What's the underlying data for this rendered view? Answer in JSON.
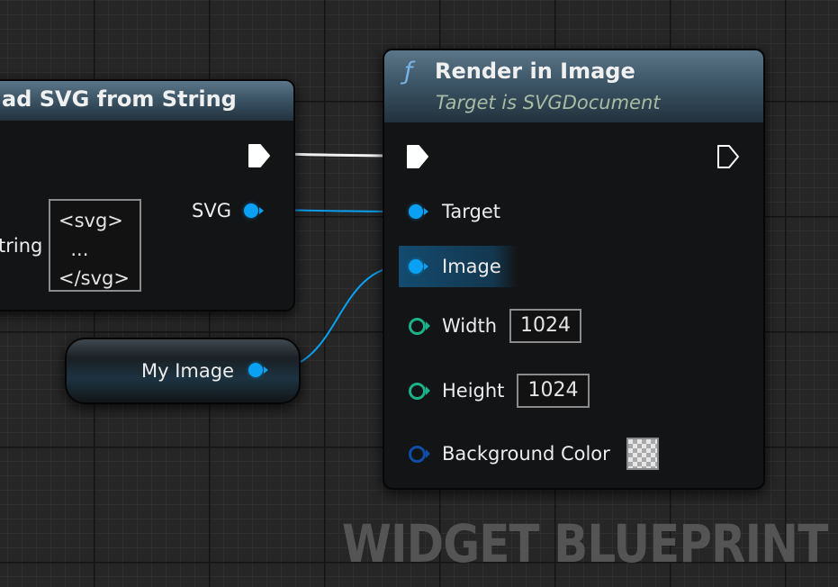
{
  "graph": {
    "watermark": "WIDGET BLUEPRINT"
  },
  "load_node": {
    "title": "ad SVG from String",
    "output_label": "SVG",
    "input_label": "tring",
    "string_value_lines": [
      "<svg>",
      "  ...",
      "</svg>"
    ]
  },
  "variable_node": {
    "label": "My Image"
  },
  "render_node": {
    "icon": "function-icon",
    "icon_glyph": "ƒ",
    "title": "Render in Image",
    "subtitle": "Target is SVGDocument",
    "pins": {
      "target": "Target",
      "image": "Image",
      "width": "Width",
      "height": "Height",
      "background_color": "Background Color"
    },
    "values": {
      "width": "1024",
      "height": "1024"
    }
  },
  "colors": {
    "object_pin": "#0aa1f4",
    "integer_pin": "#1bb28a",
    "struct_pin": "#0e4ea8",
    "exec_pin": "#ffffff",
    "header": "#3c5567"
  }
}
